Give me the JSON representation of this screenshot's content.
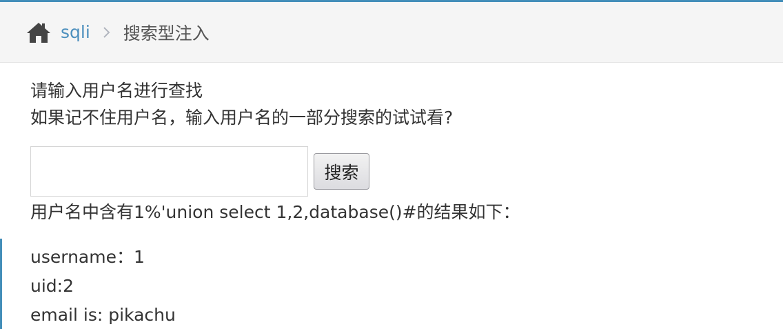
{
  "breadcrumb": {
    "home_icon": "home-icon",
    "parent_label": "sqli",
    "separator_icon": "chevron-right-icon",
    "current_label": "搜索型注入"
  },
  "prompt": {
    "line1": "请输入用户名进行查找",
    "line2": "如果记不住用户名，输入用户名的一部分搜索的试试看?"
  },
  "search": {
    "value": "",
    "placeholder": "",
    "button_label": "搜索"
  },
  "result": {
    "title": "用户名中含有1%'union select 1,2,database()#的结果如下：",
    "lines": [
      "username：1",
      "uid:2",
      "email is: pikachu"
    ]
  },
  "colors": {
    "accent": "#438eb9",
    "link": "#4c8fbd",
    "breadcrumb_bg": "#f5f5f5"
  }
}
